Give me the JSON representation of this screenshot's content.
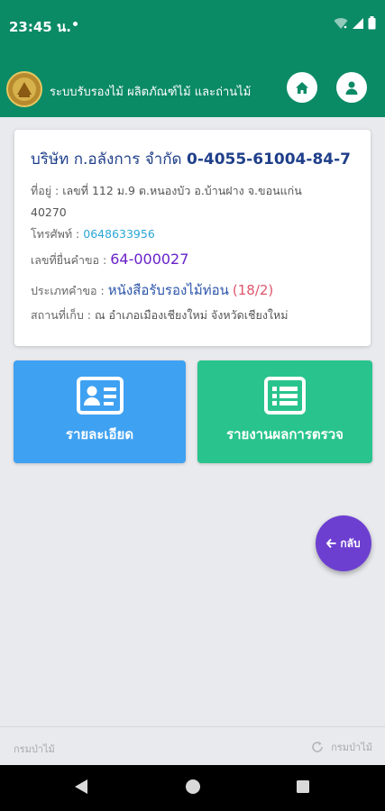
{
  "status_bar": {
    "time": "23:45 น."
  },
  "app_bar": {
    "title": "ระบบรับรองไม้ ผลิตภัณฑ์ไม้ และถ่านไม้"
  },
  "record": {
    "company": "บริษัท ก.อลังการ จำกัด",
    "company_code": "0-4055-61004-84-7",
    "address_label": "ที่อยู่ :",
    "address_line1": "เลขที่ 112 ม.9 ต.หนองบัว อ.บ้านฝาง จ.ขอนแก่น",
    "address_line2": "40270",
    "phone_label": "โทรศัพท์ :",
    "phone": "0648633956",
    "request_no_label": "เลขที่ยื่นคำขอ :",
    "request_no": "64-000027",
    "request_type_label": "ประเภทคำขอ :",
    "request_type": "หนังสือรับรองไม้ท่อน",
    "request_type_count": "(18/2)",
    "storage_label": "สถานที่เก็บ :",
    "storage": "ณ อำเภอเมืองเชียงใหม่ จังหวัดเชียงใหม่"
  },
  "tiles": {
    "detail_label": "รายละเอียด",
    "report_label": "รายงานผลการตรวจ"
  },
  "fab": {
    "label": "กลับ"
  },
  "footer": {
    "left": "กรมป่าไม้",
    "right": "กรมป่าไม้"
  },
  "colors": {
    "primary": "#0b8a66",
    "detail_tile": "#3fa1f2",
    "report_tile": "#29c48d",
    "fab": "#6d3fd1"
  }
}
